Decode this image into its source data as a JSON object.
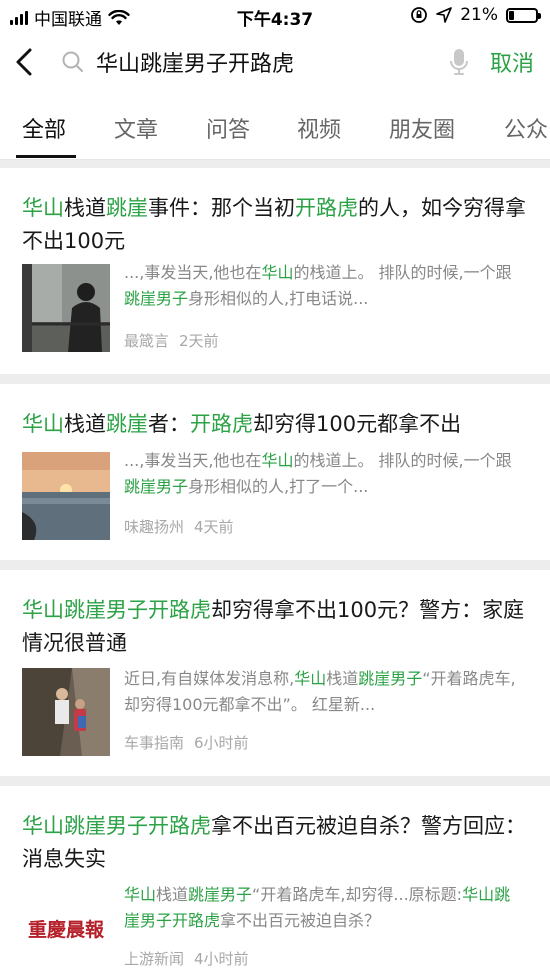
{
  "status": {
    "carrier": "中国联通",
    "time": "下午4:37",
    "battery": "21%",
    "battery_level": 0.21
  },
  "search": {
    "query": "华山跳崖男子开路虎",
    "cancel_label": "取消"
  },
  "tabs": [
    {
      "label": "全部"
    },
    {
      "label": "文章"
    },
    {
      "label": "问答"
    },
    {
      "label": "视频"
    },
    {
      "label": "朋友圈"
    },
    {
      "label": "公众"
    }
  ],
  "results": [
    {
      "title_parts": [
        {
          "text": "华山",
          "hl": true
        },
        {
          "text": "栈道",
          "hl": false
        },
        {
          "text": "跳崖",
          "hl": true
        },
        {
          "text": "事件：那个当初",
          "hl": false
        },
        {
          "text": "开路虎",
          "hl": true
        },
        {
          "text": "的人，如今穷得拿不出100元",
          "hl": false
        }
      ],
      "snippet_parts": [
        {
          "text": "...,事发当天,他也在",
          "hl": false
        },
        {
          "text": "华山",
          "hl": true
        },
        {
          "text": "的栈道上。 排队的时候,一个跟",
          "hl": false
        },
        {
          "text": "跳崖男子",
          "hl": true
        },
        {
          "text": "身形相似的人,打电话说...",
          "hl": false
        }
      ],
      "source": "最箴言",
      "time": "2天前",
      "thumb": "man-on-plank-path-photo"
    },
    {
      "title_parts": [
        {
          "text": "华山",
          "hl": true
        },
        {
          "text": "栈道",
          "hl": false
        },
        {
          "text": "跳崖",
          "hl": true
        },
        {
          "text": "者：",
          "hl": false
        },
        {
          "text": "开路虎",
          "hl": true
        },
        {
          "text": "却穷得100元都拿不出",
          "hl": false
        }
      ],
      "snippet_parts": [
        {
          "text": "...,事发当天,他也在",
          "hl": false
        },
        {
          "text": "华山",
          "hl": true
        },
        {
          "text": "的栈道上。 排队的时候,一个跟",
          "hl": false
        },
        {
          "text": "跳崖男子",
          "hl": true
        },
        {
          "text": "身形相似的人,打了一个...",
          "hl": false
        }
      ],
      "source": "味趣扬州",
      "time": "4天前",
      "thumb": "sunset-sea-photo"
    },
    {
      "title_parts": [
        {
          "text": "华山跳崖男子开路虎",
          "hl": true
        },
        {
          "text": "却穷得拿不出100元？警方：家庭情况很普通",
          "hl": false
        }
      ],
      "snippet_parts": [
        {
          "text": "近日,有自媒体发消息称,",
          "hl": false
        },
        {
          "text": "华山",
          "hl": true
        },
        {
          "text": "栈道",
          "hl": false
        },
        {
          "text": "跳崖男子",
          "hl": true
        },
        {
          "text": "“开着路虎车,却穷得100元都拿不出”。 红星新...",
          "hl": false
        }
      ],
      "source": "车事指南",
      "time": "6小时前",
      "thumb": "cliff-path-climbers-photo"
    },
    {
      "title_parts": [
        {
          "text": "华山跳崖男子开路虎",
          "hl": true
        },
        {
          "text": "拿不出百元被迫自杀？警方回应：消息失实",
          "hl": false
        }
      ],
      "snippet_parts": [
        {
          "text": "华山",
          "hl": true
        },
        {
          "text": "栈道",
          "hl": false
        },
        {
          "text": "跳崖男子",
          "hl": true
        },
        {
          "text": "“开着路虎车,却穷得...原标题:",
          "hl": false
        },
        {
          "text": "华山跳崖男子开路虎",
          "hl": true
        },
        {
          "text": "拿不出百元被迫自杀？",
          "hl": false
        }
      ],
      "source": "上游新闻",
      "time": "4小时前",
      "thumb": "chongqing-morning-news-logo",
      "thumb_text": "重慶晨報"
    }
  ]
}
